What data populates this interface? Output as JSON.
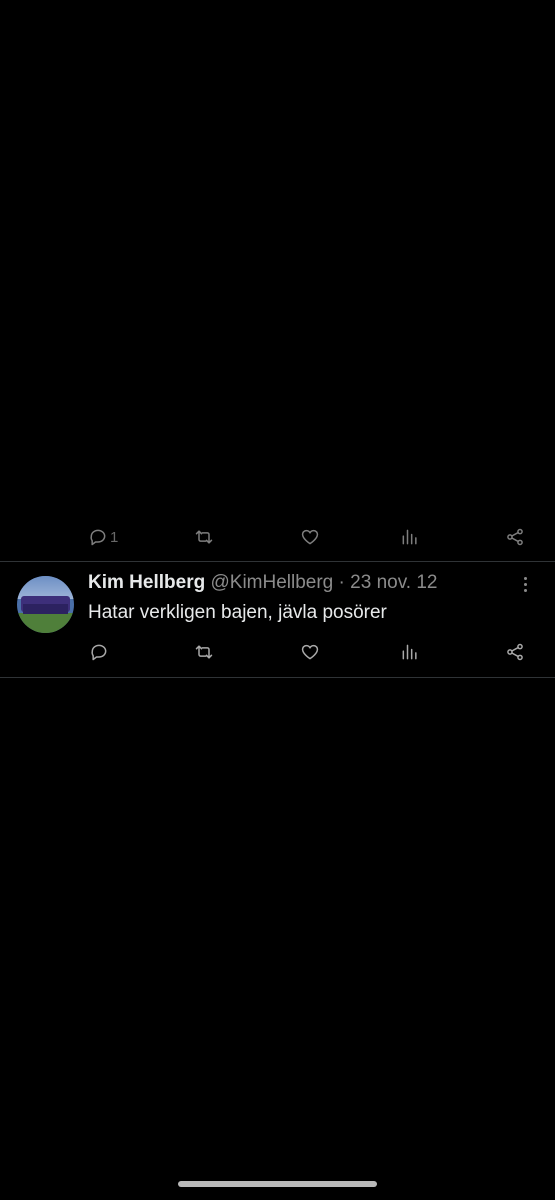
{
  "previous_tweet": {
    "reply_count": "1"
  },
  "tweet": {
    "author_name": "Kim Hellberg",
    "handle": "@KimHellberg",
    "separator": "·",
    "date": "23 nov. 12",
    "text": "Hatar verkligen bajen, jävla posörer",
    "avatar_description": "team photo"
  },
  "icons": {
    "reply": "reply-icon",
    "retweet": "retweet-icon",
    "like": "heart-icon",
    "views": "views-icon",
    "share": "share-icon",
    "more": "more-icon"
  },
  "colors": {
    "background": "#000000",
    "primary_text": "#e7e9ea",
    "secondary_text": "#8b8b8b",
    "divider": "#2f3336"
  }
}
